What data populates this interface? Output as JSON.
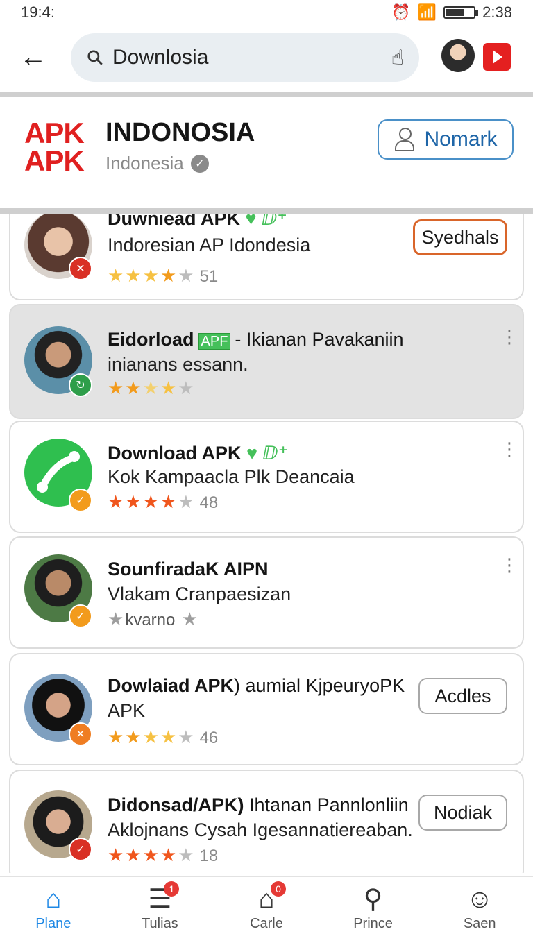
{
  "status": {
    "time": "19:4:",
    "clock": "2:38"
  },
  "search": {
    "value": "Downlosia"
  },
  "channel": {
    "logo": "APK APK",
    "title": "INDONOSIA",
    "subtitle": "Indonesia",
    "follow_label": "Nomark"
  },
  "cards": [
    {
      "title": "Duwniead APK",
      "subtitle": "Indoresian AP Idondesia",
      "rating": "51",
      "action": "Syedhals"
    },
    {
      "title": "Eidorload",
      "tag": "APF",
      "title_rest": "- Ikianan Pavakaniin",
      "subtitle": "inianans essann."
    },
    {
      "title": "Download APK",
      "subtitle": "Kok Kampaacla Plk Deancaia",
      "rating": "48"
    },
    {
      "title": "SounfiradaK AIPN",
      "subtitle": "Vlakam Cranpaesizan",
      "rating_text": "kvarno"
    },
    {
      "title": "Dowlaiad APK",
      "title_rest": ") aumial KjpeuryoPK",
      "subtitle": "APK",
      "rating": "46",
      "action": "Acdles"
    },
    {
      "title": "Didonsad/APK)",
      "title_rest": "Ihtanan Pannlonliin",
      "subtitle": "Aklojnans Cysah Igesannatiereaban.",
      "rating": "18",
      "action": "Nodiak"
    }
  ],
  "nav": [
    {
      "label": "Plane",
      "icon": "home-icon"
    },
    {
      "label": "Tulias",
      "icon": "list-icon",
      "badge": "1"
    },
    {
      "label": "Carle",
      "icon": "house-icon",
      "badge": "0"
    },
    {
      "label": "Prince",
      "icon": "search-icon"
    },
    {
      "label": "Saen",
      "icon": "profile-icon"
    }
  ],
  "colors": {
    "accent": "#1e88e5",
    "brand_red": "#e02020",
    "star_orange": "#f29b1d"
  }
}
